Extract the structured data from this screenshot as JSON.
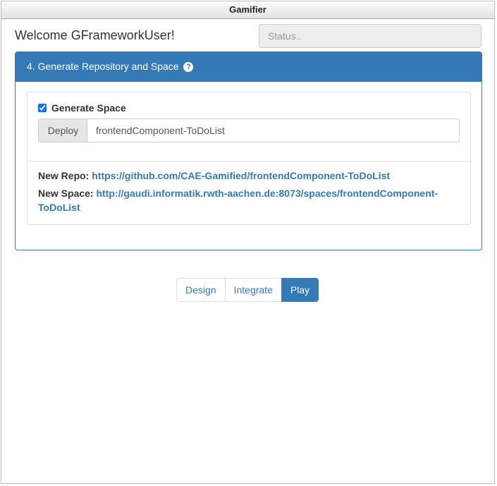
{
  "window": {
    "title": "Gamifier"
  },
  "header": {
    "welcome": "Welcome GFrameworkUser!",
    "status_placeholder": "Status.."
  },
  "panel": {
    "title": "4. Generate Repository and Space",
    "help_icon": "question-circle-icon",
    "generate_space": {
      "label": "Generate Space",
      "checked": true
    },
    "deploy": {
      "button_label": "Deploy",
      "input_value": "frontendComponent-ToDoList"
    },
    "new_repo": {
      "label": "New Repo:",
      "url": "https://github.com/CAE-Gamified/frontendComponent-ToDoList"
    },
    "new_space": {
      "label": "New Space:",
      "url": "http://gaudi.informatik.rwth-aachen.de:8073/spaces/frontendComponent-ToDoList"
    }
  },
  "nav": {
    "items": [
      {
        "label": "Design",
        "active": false
      },
      {
        "label": "Integrate",
        "active": false
      },
      {
        "label": "Play",
        "active": true
      }
    ]
  },
  "colors": {
    "primary": "#337ab7",
    "border": "#dddddd"
  }
}
